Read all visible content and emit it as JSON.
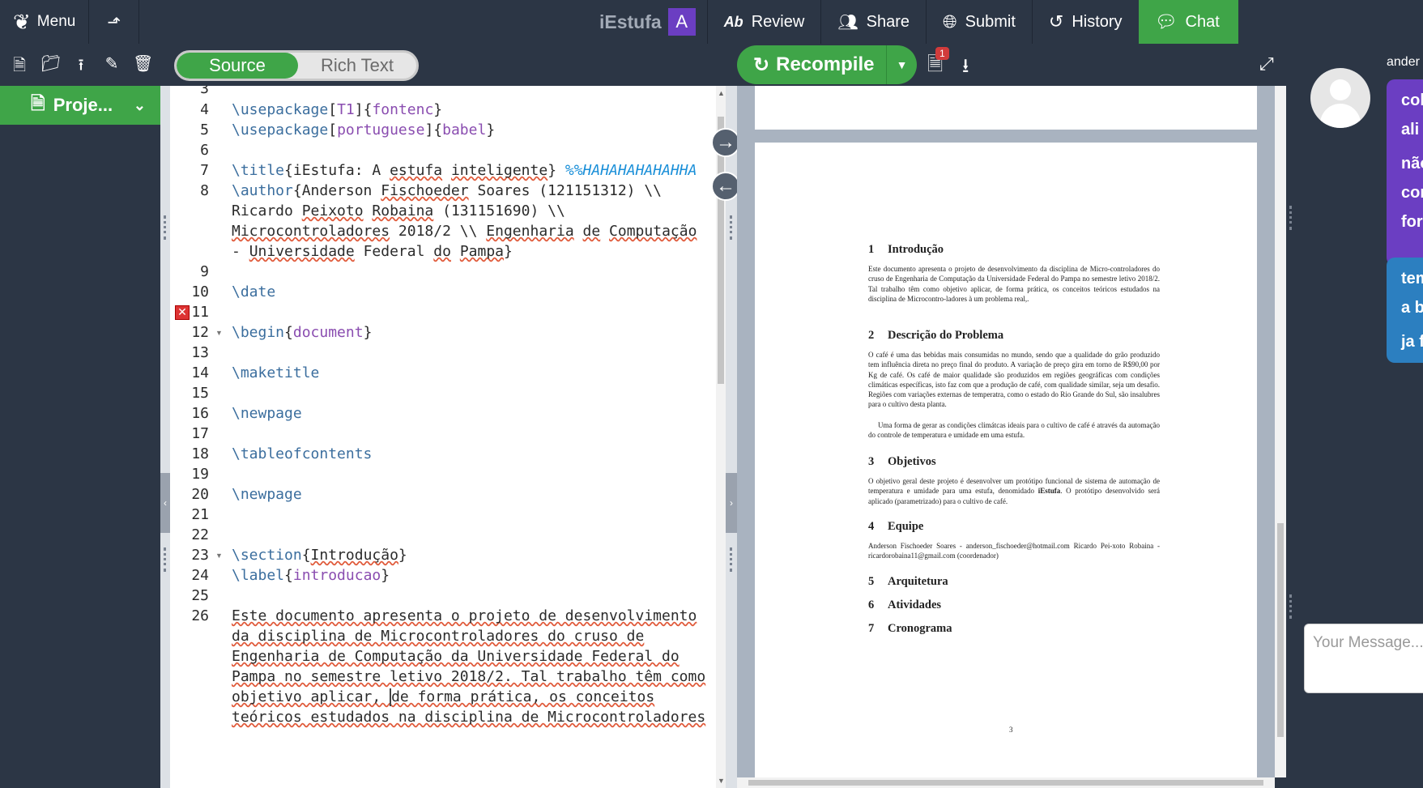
{
  "topbar": {
    "menu_label": "Menu",
    "project_name": "iEstufa",
    "avatar_letter": "A",
    "review_label": "Review",
    "share_label": "Share",
    "submit_label": "Submit",
    "history_label": "History",
    "chat_label": "Chat"
  },
  "toolbar": {
    "source_label": "Source",
    "rich_text_label": "Rich Text",
    "recompile_label": "Recompile",
    "logs_badge": "1"
  },
  "sidebar": {
    "project_tab_label": "Proje..."
  },
  "editor": {
    "line_numbers": [
      "3",
      "4",
      "5",
      "6",
      "7",
      "8",
      "",
      "",
      "",
      "9",
      "10",
      "11",
      "12",
      "13",
      "14",
      "15",
      "16",
      "17",
      "18",
      "19",
      "20",
      "21",
      "22",
      "23",
      "24",
      "25",
      "26",
      "",
      "",
      "",
      ""
    ],
    "lines": {
      "l4a": "\\usepackage",
      "l4b": "[",
      "l4c": "T1",
      "l4d": "]{",
      "l4e": "fontenc",
      "l4f": "}",
      "l5a": "\\usepackage",
      "l5c": "portuguese",
      "l5e": "babel",
      "l7a": "\\title",
      "l7b": "{",
      "l7c": "iEstufa",
      "l7d": ": A ",
      "l7e": "estufa",
      "l7f": " ",
      "l7g": "inteligente",
      "l7h": "} ",
      "l7i": "%%HAHAHAHAHAHHA",
      "l8a": "\\author",
      "l8b": "{Anderson ",
      "l8c": "Fischoeder",
      "l8d": " Soares (121151312) \\\\",
      "l8e_a": "Ricardo ",
      "l8e_b": "Peixoto",
      "l8e_c": " ",
      "l8e_d": "Robaina",
      "l8e_e": " (131151690) \\\\",
      "l8f_a": "Microcontroladores",
      "l8f_b": " 2018/2 \\\\ ",
      "l8f_c": "Engenharia",
      "l8f_d": " ",
      "l8f_e": "de",
      "l8f_f": " ",
      "l8f_g": "Computação",
      "l8g_a": "- ",
      "l8g_b": "Universidade",
      "l8g_c": " Federal ",
      "l8g_d": "do",
      "l8g_e": " ",
      "l8g_f": "Pampa",
      "l8g_g": "}",
      "l10": "\\date",
      "l12a": "\\begin",
      "l12b": "{",
      "l12c": "document",
      "l12d": "}",
      "l14": "\\maketitle",
      "l16": "\\newpage",
      "l18": "\\tableofcontents",
      "l20": "\\newpage",
      "l23a": "\\section",
      "l23b": "{",
      "l23c": "Introdução",
      "l23d": "}",
      "l24a": "\\label",
      "l24b": "{",
      "l24c": "introducao",
      "l24d": "}",
      "p1": "Este documento apresenta o projeto de desenvolvimento",
      "p2": "da disciplina de Microcontroladores do cruso de",
      "p3": "Engenharia de Computação da Universidade Federal do",
      "p4": "Pampa no semestre letivo 2018/2. Tal trabalho têm como",
      "p5a": "objetivo aplicar, ",
      "p5b": "de forma prática, os conceitos",
      "p6": "teóricos estudados na disciplina de Microcontroladores"
    }
  },
  "pdf": {
    "sections": [
      {
        "num": "1",
        "title": "Introdução"
      },
      {
        "num": "2",
        "title": "Descrição do Problema"
      },
      {
        "num": "3",
        "title": "Objetivos"
      },
      {
        "num": "4",
        "title": "Equipe"
      },
      {
        "num": "5",
        "title": "Arquitetura"
      },
      {
        "num": "6",
        "title": "Atividades"
      },
      {
        "num": "7",
        "title": "Cronograma"
      }
    ],
    "intro_text": "Este documento apresenta o projeto de desenvolvimento da disciplina de Micro-controladores do cruso de Engenharia de Computação da Universidade Federal do Pampa no semestre letivo 2018/2. Tal trabalho têm como objetivo aplicar, de forma prática, os conceitos teóricos estudados na disciplina de Microcontro-ladores à um problema real,.",
    "problem_text": "O café é uma das bebidas mais consumidas no mundo, sendo que a qualidade do grão produzido tem influência direta no preço final do produto. A variação de preço gira em torno de R$90,00 por Kg de café. Os café de maior qualidade são produzidos em regiões geográficas com condições climáticas específicas, isto faz com que a produção de café, com qualidade similar, seja um desafio. Regiões com variações externas de temperatra, como o estado do Rio Grande do Sul, são insalubres para o cultivo desta planta.",
    "problem_text2": "Uma forma de gerar as condições climátcas ideais para o cultivo de café é através da automação do controle de temperatura e umidade em uma estufa.",
    "objectives_text_a": "O objetivo geral deste projeto é desenvolver um protótipo funcional de sistema de automação de temperatura e umidade para uma estufa, denomidado ",
    "objectives_text_b": "iEstufa",
    "objectives_text_c": ". O protótipo desenvolvido será aplicado (parametrizado) para o cultivo de café.",
    "team_text": "Anderson Fischoeder Soares - anderson_fischoeder@hotmail.com Ricardo Pei-xoto Robaina - ricardorobaina11@gmail.com (coordenador)",
    "page_number": "3"
  },
  "chat": {
    "user_label": "ander",
    "bubble1": [
      "col",
      "ali",
      "não",
      "cor",
      "for"
    ],
    "bubble2": [
      "tem",
      "a bi",
      "ja fa"
    ],
    "input_placeholder": "Your Message..."
  }
}
